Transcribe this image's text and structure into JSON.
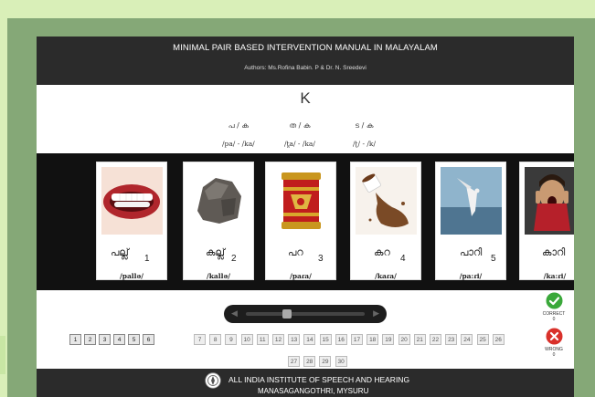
{
  "header": {
    "title": "MINIMAL PAIR BASED INTERVENTION MANUAL IN MALAYALAM",
    "authors": "Authors: Ms.Rofina Babin. P & Dr. N. Sreedevi"
  },
  "phoneme": "K",
  "pairs": [
    {
      "mal": "പ / ക",
      "ipa": "/pa/ - /ka/"
    },
    {
      "mal": "ത / ക",
      "ipa": "/t̪a/ - /ka/"
    },
    {
      "mal": "ട / ക",
      "ipa": "/ʈ/ - /k/"
    }
  ],
  "cards": [
    {
      "word": "പല്ല്",
      "number": "1",
      "ipa": "/pallə/",
      "icon": "teeth-image"
    },
    {
      "word": "കല്ല്",
      "number": "2",
      "ipa": "/kallə/",
      "icon": "rock-image"
    },
    {
      "word": "പറ",
      "number": "3",
      "ipa": "/paɾa/",
      "icon": "para-vessel-image"
    },
    {
      "word": "കറ",
      "number": "4",
      "ipa": "/kaɾa/",
      "icon": "stain-image"
    },
    {
      "word": "പാറി",
      "number": "5",
      "ipa": "/pa:ɾi/",
      "icon": "bird-flying-image"
    },
    {
      "word": "കാറി",
      "number": "",
      "ipa": "/ka:ɾi/",
      "icon": "screaming-boy-image"
    }
  ],
  "pages_left": [
    "1",
    "2",
    "3",
    "4",
    "5",
    "6"
  ],
  "pages_right": [
    "7",
    "8",
    "9",
    "10",
    "11",
    "12",
    "13",
    "14",
    "15",
    "16",
    "17",
    "18",
    "19",
    "20",
    "21",
    "22",
    "23",
    "24",
    "25",
    "26"
  ],
  "pages_bottom": [
    "27",
    "28",
    "29",
    "30"
  ],
  "correct": {
    "label": "CORRECT",
    "count": "0"
  },
  "wrong": {
    "label": "WRONG",
    "count": "0"
  },
  "footer": {
    "line1": "ALL INDIA INSTITUTE OF SPEECH AND HEARING",
    "line2": "MANASAGANGOTHRI, MYSURU"
  },
  "colors": {
    "frame": "#85a877",
    "header": "#2b2b2b",
    "strip": "#111111",
    "correct": "#3aa83a",
    "wrong": "#d9312b"
  }
}
